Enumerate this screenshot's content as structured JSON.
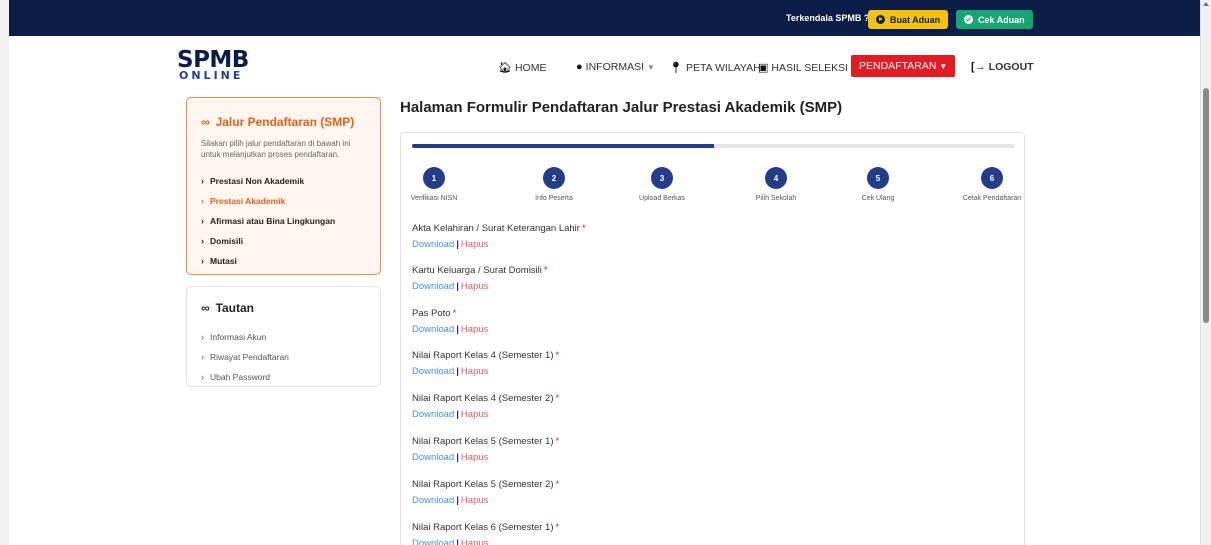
{
  "topbar": {
    "help_text": "Terkendala SPMB ?",
    "buat_aduan": "Buat Aduan",
    "cek_aduan": "Cek Aduan"
  },
  "logo": {
    "line1": "SPMB",
    "line2": "ONLINE"
  },
  "nav": {
    "home": "HOME",
    "informasi": "INFORMASI",
    "peta_wilayah": "PETA WILAYAH",
    "hasil_seleksi": "HASIL SELEKSI",
    "pendaftaran": "PENDAFTARAN",
    "logout": "LOGOUT"
  },
  "sidebar": {
    "jalur": {
      "title": "Jalur Pendaftaran (SMP)",
      "description": "Silakan pilih jalur pendaftaran di bawah ini untuk melanjutkan proses pendaftaran.",
      "items": [
        {
          "label": "Prestasi Non Akademik",
          "active": false
        },
        {
          "label": "Prestasi Akademik",
          "active": true
        },
        {
          "label": "Afirmasi atau Bina Lingkungan",
          "active": false
        },
        {
          "label": "Domisili",
          "active": false
        },
        {
          "label": "Mutasi",
          "active": false
        }
      ]
    },
    "tautan": {
      "title": "Tautan",
      "items": [
        {
          "label": "Informasi Akun"
        },
        {
          "label": "Riwayat Pendaftaran"
        },
        {
          "label": "Ubah Password"
        }
      ]
    }
  },
  "main": {
    "title": "Halaman Formulir Pendaftaran Jalur Prestasi Akademik (SMP)",
    "progress_fraction": 0.5,
    "steps": [
      {
        "number": "1",
        "label": "Verifikasi NISN"
      },
      {
        "number": "2",
        "label": "Info Peserta"
      },
      {
        "number": "3",
        "label": "Upload Berkas"
      },
      {
        "number": "4",
        "label": "Pilih Sekolah"
      },
      {
        "number": "5",
        "label": "Cek Ulang"
      },
      {
        "number": "6",
        "label": "Cetak Pendaftaran"
      }
    ],
    "download_label": "Download",
    "separator": "|",
    "hapus_label": "Hapus",
    "required_mark": "*",
    "documents": [
      {
        "title": "Akta Kelahiran / Surat Keterangan Lahir"
      },
      {
        "title": "Kartu Keluarga / Surat Domisili"
      },
      {
        "title": "Pas Poto"
      },
      {
        "title": "Nilai Raport Kelas 4 (Semester 1)"
      },
      {
        "title": "Nilai Raport Kelas 4 (Semester 2)"
      },
      {
        "title": "Nilai Raport Kelas 5 (Semester 1)"
      },
      {
        "title": "Nilai Raport Kelas 5 (Semester 2)"
      },
      {
        "title": "Nilai Raport Kelas 6 (Semester 1)"
      }
    ]
  },
  "colors": {
    "navy": "#0c1d48",
    "accent_orange": "#e5621a",
    "red": "#e31b23",
    "link_blue": "#4a90d9",
    "hapus_pink": "#e85c6a",
    "step_blue": "#233d8a"
  }
}
